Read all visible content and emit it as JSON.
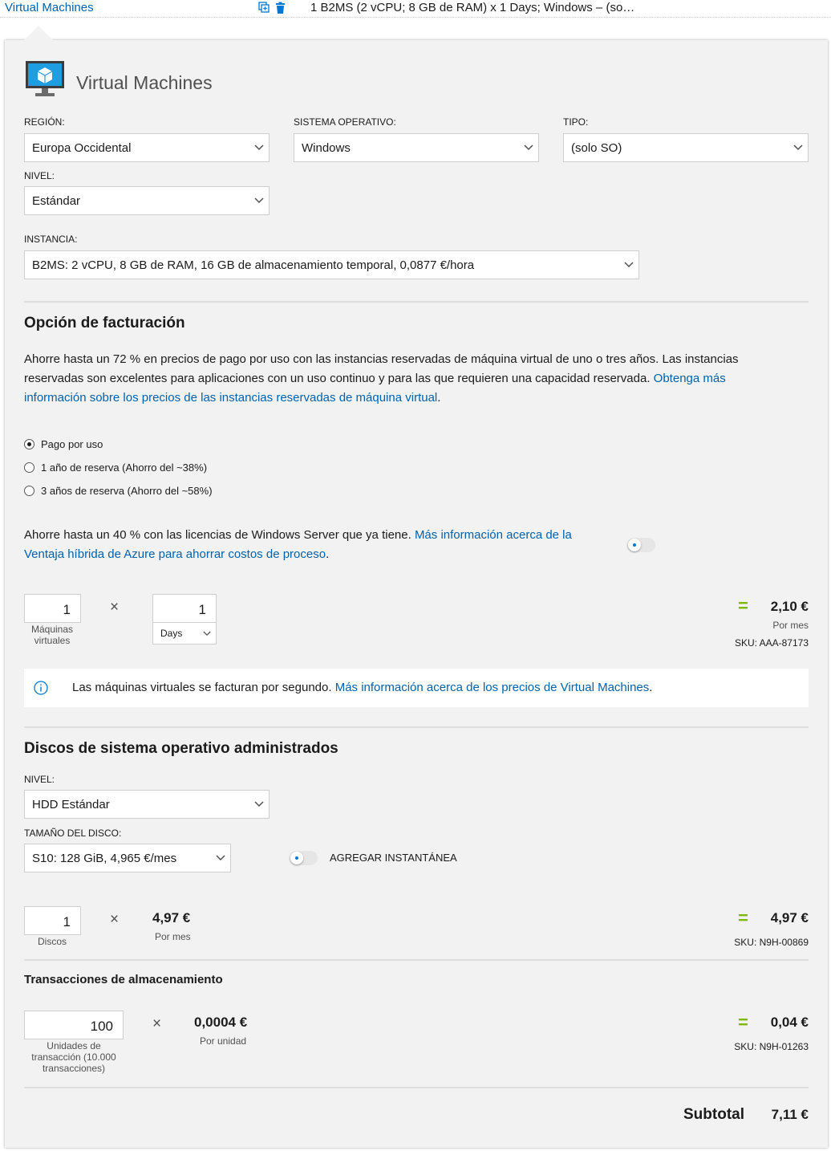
{
  "topbar": {
    "title": "Virtual Machines",
    "summary": "1 B2MS (2 vCPU; 8 GB de RAM) x 1 Days; Windows – (so…",
    "icons": [
      "copy-icon",
      "delete-icon"
    ]
  },
  "header": {
    "title": "Virtual Machines",
    "icon": "virtual-machine-icon"
  },
  "fields": {
    "region": {
      "label": "REGIÓN:",
      "value": "Europa Occidental"
    },
    "os": {
      "label": "SISTEMA OPERATIVO:",
      "value": "Windows"
    },
    "type": {
      "label": "TIPO:",
      "value": "(solo SO)"
    },
    "tier": {
      "label": "NIVEL:",
      "value": "Estándar"
    },
    "instance": {
      "label": "INSTANCIA:",
      "value": "B2MS: 2 vCPU, 8 GB de RAM, 16 GB de almacenamiento temporal, 0,0877 €/hora"
    }
  },
  "billing": {
    "title": "Opción de facturación",
    "text": "Ahorre hasta un 72 % en precios de pago por uso con las instancias reservadas de máquina virtual de uno o tres años. Las instancias reservadas son excelentes para aplicaciones con un uso continuo y para las que requieren una capacidad reservada. ",
    "link": "Obtenga más información sobre los precios de las instancias reservadas de máquina virtual",
    "text_end": ".",
    "options": [
      {
        "label": "Pago por uso",
        "checked": true
      },
      {
        "label": "1 año de reserva (Ahorro del ~38%)",
        "checked": false
      },
      {
        "label": "3 años de reserva (Ahorro del ~58%)",
        "checked": false
      }
    ],
    "hybrid_text": "Ahorre hasta un 40 % con las licencias de Windows Server que ya tiene. ",
    "hybrid_link": "Más información acerca de la Ventaja híbrida de Azure para ahorrar costos de proceso",
    "hybrid_end": "."
  },
  "vm_calc": {
    "count": "1",
    "count_label": "Máquinas virtuales",
    "times": "×",
    "duration": "1",
    "duration_unit": "Days",
    "equals": "=",
    "total": "2,10 €",
    "period": "Por mes",
    "sku": "SKU: AAA-87173"
  },
  "info": {
    "icon": "info-icon",
    "text": "Las máquinas virtuales se facturan por segundo. ",
    "link": "Más información acerca de los precios de Virtual Machines",
    "text_end": "."
  },
  "disks": {
    "title": "Discos de sistema operativo administrados",
    "tier_label": "NIVEL:",
    "tier_value": "HDD Estándar",
    "size_label": "TAMAÑO DEL DISCO:",
    "size_value": "S10: 128 GiB, 4,965 €/mes",
    "snapshot_label": "AGREGAR INSTANTÁNEA",
    "count": "1",
    "count_label": "Discos",
    "times": "×",
    "unit_price": "4,97 €",
    "unit_period": "Por mes",
    "equals": "=",
    "total": "4,97 €",
    "sku": "SKU: N9H-00869"
  },
  "transactions": {
    "title": "Transacciones de almacenamiento",
    "count": "100",
    "count_label": "Unidades de transacción (10.000 transacciones)",
    "times": "×",
    "unit_price": "0,0004 €",
    "unit_period": "Por unidad",
    "equals": "=",
    "total": "0,04 €",
    "sku": "SKU: N9H-01263"
  },
  "subtotal": {
    "label": "Subtotal",
    "value": "7,11 €"
  },
  "colors": {
    "accent": "#0062ad",
    "equals": "#7fba00",
    "panel": "#f2f2f2"
  }
}
